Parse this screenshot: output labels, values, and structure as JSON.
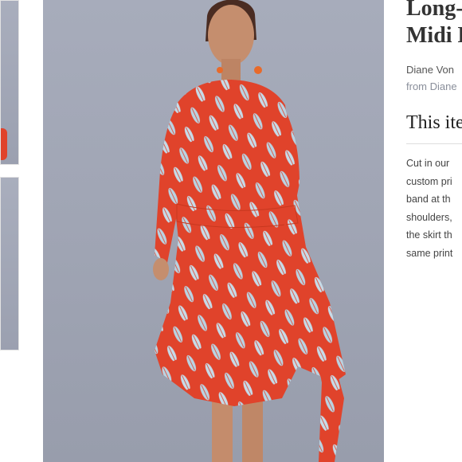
{
  "product": {
    "title_line1": "Long-",
    "title_line2": "Midi D",
    "brand": "Diane Von",
    "from": "from Diane"
  },
  "section": {
    "title": "This ite"
  },
  "description": {
    "lines": [
      "Cut in our",
      "custom pri",
      "band at th",
      "shoulders,",
      "the skirt th",
      "same print"
    ]
  },
  "colors": {
    "dress_red": "#e0432b",
    "leaf_blue": "#b9d3e2",
    "backdrop": "#a2a7b6"
  }
}
